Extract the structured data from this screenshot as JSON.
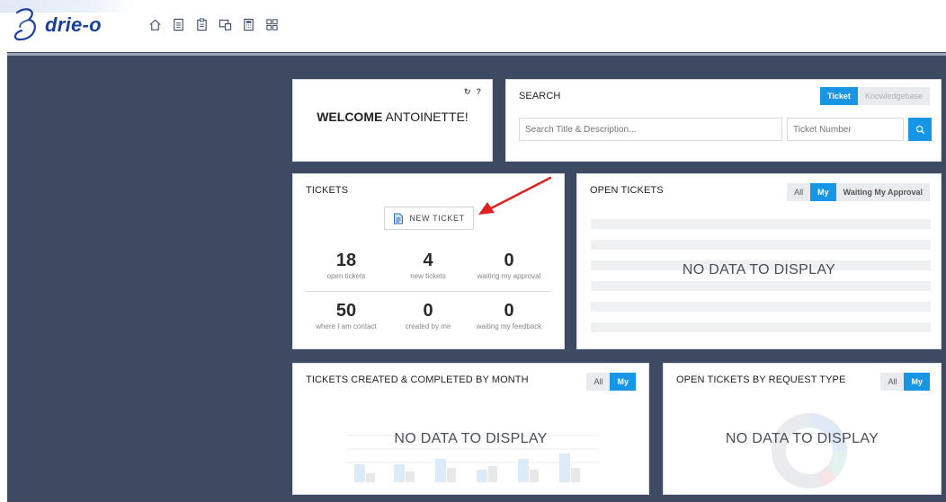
{
  "app": {
    "name": "drie-o"
  },
  "nav": {
    "icons": [
      "home-icon",
      "document-icon",
      "clipboard-icon",
      "screens-icon",
      "calculator-icon",
      "grid-icon"
    ]
  },
  "welcome": {
    "greeting": "WELCOME",
    "user": " ANTOINETTE!",
    "refresh_glyph": "↻",
    "help_glyph": "?"
  },
  "search": {
    "title": "SEARCH",
    "tab_ticket": "Ticket",
    "tab_kb": "Knowledgebase",
    "placeholder": "Search Title & Description...",
    "number_placeholder": "Ticket Number"
  },
  "tickets": {
    "title": "TICKETS",
    "new_button": "NEW TICKET",
    "stats": [
      {
        "value": "18",
        "label": "open tickets"
      },
      {
        "value": "4",
        "label": "new tickets"
      },
      {
        "value": "0",
        "label": "waiting my approval"
      },
      {
        "value": "50",
        "label": "where I am contact"
      },
      {
        "value": "0",
        "label": "created by me"
      },
      {
        "value": "0",
        "label": "waiting my feedback"
      }
    ]
  },
  "open_tickets": {
    "title": "OPEN TICKETS",
    "filter_all": "All",
    "filter_my": "My",
    "filter_waiting": "Waiting My Approval",
    "empty": "NO DATA TO DISPLAY"
  },
  "monthly": {
    "title": "TICKETS CREATED & COMPLETED BY MONTH",
    "filter_all": "All",
    "filter_my": "My",
    "empty": "NO DATA TO DISPLAY"
  },
  "by_type": {
    "title": "OPEN TICKETS BY REQUEST TYPE",
    "filter_all": "All",
    "filter_my": "My",
    "empty": "NO DATA TO DISPLAY"
  },
  "colors": {
    "accent": "#1896e6",
    "sidebar": "#3e4a62",
    "brand": "#1a3f9c",
    "annotation_arrow": "#e02020"
  }
}
